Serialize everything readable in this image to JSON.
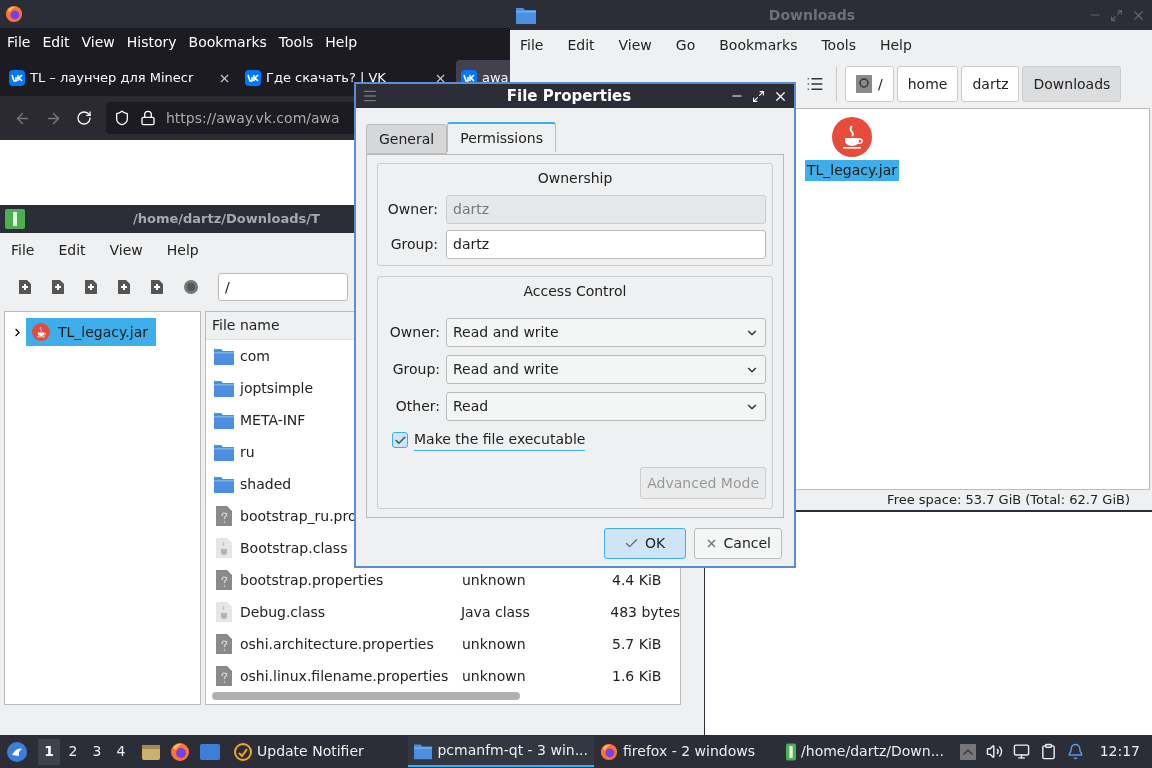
{
  "firefox": {
    "menu": [
      "File",
      "Edit",
      "View",
      "History",
      "Bookmarks",
      "Tools",
      "Help"
    ],
    "tabs": [
      {
        "title": "TL – лаунчер для Minecr",
        "selected": false
      },
      {
        "title": "Где скачать? | VK",
        "selected": false
      },
      {
        "title": "awa",
        "selected": true
      }
    ],
    "url_host": "https://away.vk.com/awa"
  },
  "downloads_window": {
    "title": "Downloads",
    "menu": [
      "File",
      "Edit",
      "View",
      "Go",
      "Bookmarks",
      "Tools",
      "Help"
    ],
    "breadcrumbs": [
      {
        "label": "/",
        "kind": "root",
        "selected": false
      },
      {
        "label": "home",
        "kind": "dir",
        "selected": false
      },
      {
        "label": "dartz",
        "kind": "dir",
        "selected": false
      },
      {
        "label": "Downloads",
        "kind": "dir",
        "selected": true
      }
    ],
    "files": [
      {
        "name": "TL_legacy.jar",
        "selected": true
      }
    ],
    "status": "Free space: 53.7 GiB (Total: 62.7 GiB)"
  },
  "archive_window": {
    "title": "/home/dartz/Downloads/T",
    "menu": [
      "File",
      "Edit",
      "View",
      "Help"
    ],
    "path": "/",
    "tree": [
      {
        "label": "TL_legacy.jar",
        "selected": true,
        "expanded": false
      }
    ],
    "columns": [
      "File name"
    ],
    "rows": [
      {
        "kind": "folder",
        "name": "com"
      },
      {
        "kind": "folder",
        "name": "joptsimple"
      },
      {
        "kind": "folder",
        "name": "META-INF"
      },
      {
        "kind": "folder",
        "name": "ru"
      },
      {
        "kind": "folder",
        "name": "shaded"
      },
      {
        "kind": "unknown",
        "name": "bootstrap_ru.pro"
      },
      {
        "kind": "class",
        "name": "Bootstrap.class"
      },
      {
        "kind": "unknown",
        "name": "bootstrap.properties",
        "type": "unknown",
        "size": "4.4 KiB"
      },
      {
        "kind": "class",
        "name": "Debug.class",
        "type": "Java class",
        "size": "483 bytes"
      },
      {
        "kind": "unknown",
        "name": "oshi.architecture.properties",
        "type": "unknown",
        "size": "5.7 KiB"
      },
      {
        "kind": "unknown",
        "name": "oshi.linux.filename.properties",
        "type": "unknown",
        "size": "1.6 KiB"
      }
    ]
  },
  "dialog": {
    "title": "File Properties",
    "tabs": [
      {
        "label": "General",
        "selected": false
      },
      {
        "label": "Permissions",
        "selected": true
      }
    ],
    "ownership": {
      "title": "Ownership",
      "fields": [
        {
          "label": "Owner:",
          "value": "dartz",
          "disabled": true
        },
        {
          "label": "Group:",
          "value": "dartz",
          "disabled": false
        }
      ]
    },
    "access": {
      "title": "Access Control",
      "selects": [
        {
          "label": "Owner:",
          "value": "Read and write"
        },
        {
          "label": "Group:",
          "value": "Read and write"
        },
        {
          "label": "Other:",
          "value": "Read"
        }
      ],
      "executable": {
        "label": "Make the file executable",
        "checked": true
      },
      "advanced": {
        "label": "Advanced Mode",
        "disabled": true
      }
    },
    "buttons": [
      {
        "label": "OK",
        "kind": "ok",
        "default": true
      },
      {
        "label": "Cancel",
        "kind": "cancel",
        "default": false
      }
    ]
  },
  "taskbar": {
    "workspaces": [
      {
        "label": "1",
        "selected": true
      },
      {
        "label": "2",
        "selected": false
      },
      {
        "label": "3",
        "selected": false
      },
      {
        "label": "4",
        "selected": false
      }
    ],
    "tasks": [
      {
        "label": "Update Notifier",
        "kind": "notifier",
        "selected": false
      },
      {
        "label": "pcmanfm-qt - 3 win...",
        "kind": "folder",
        "selected": true
      },
      {
        "label": "firefox - 2 windows",
        "kind": "firefox",
        "selected": false
      },
      {
        "label": "/home/dartz/Down...",
        "kind": "archive",
        "selected": false
      }
    ],
    "clock": "12:17"
  }
}
